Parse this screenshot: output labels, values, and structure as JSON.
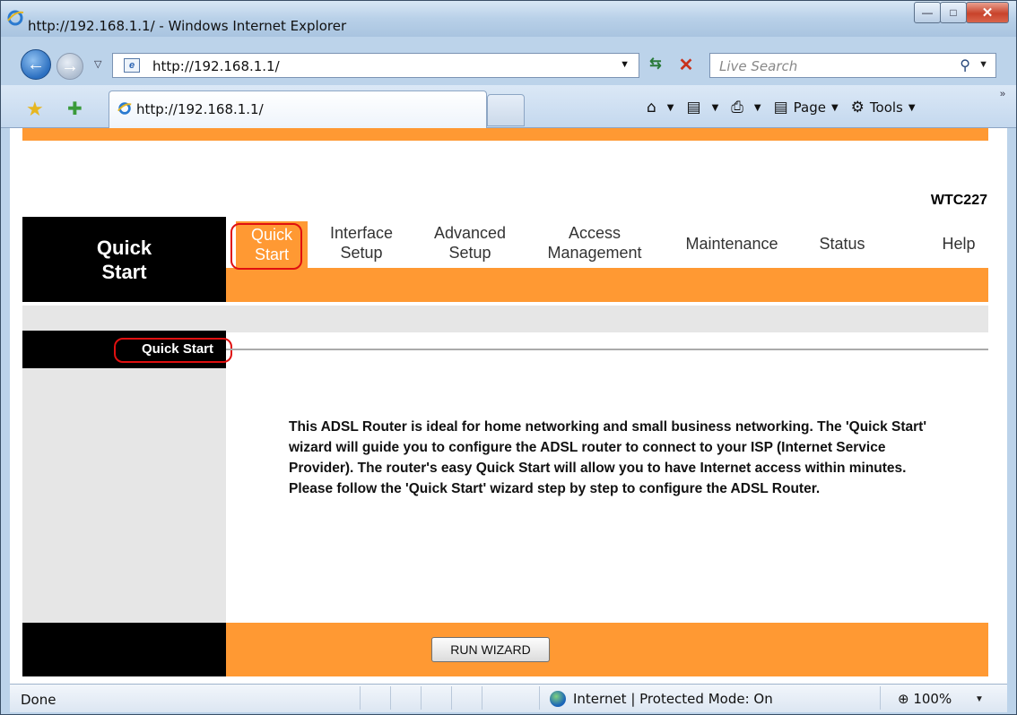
{
  "browser": {
    "window_title": "http://192.168.1.1/ - Windows Internet Explorer",
    "address_url": "http://192.168.1.1/",
    "search_placeholder": "Live Search",
    "tab_title": "http://192.168.1.1/",
    "commands": {
      "page": "Page",
      "tools": "Tools"
    }
  },
  "router": {
    "model": "WTC227",
    "sidebar_title": "Quick Start",
    "menu": [
      {
        "label": "Quick Start",
        "active": true
      },
      {
        "label": "Interface Setup",
        "active": false
      },
      {
        "label": "Advanced Setup",
        "active": false
      },
      {
        "label": "Access Management",
        "active": false
      },
      {
        "label": "Maintenance",
        "active": false
      },
      {
        "label": "Status",
        "active": false
      },
      {
        "label": "Help",
        "active": false
      }
    ],
    "section_title": "Quick Start",
    "description": "This ADSL Router is ideal for home networking and small business networking. The 'Quick Start' wizard will guide you to configure the ADSL router to connect to your ISP (Internet Service Provider). The router's easy Quick Start will allow you to have Internet access within minutes. Please follow the 'Quick Start' wizard step by step to configure the ADSL Router.",
    "run_wizard_label": "RUN WIZARD",
    "accent_color": "#ff9933",
    "highlight_color": "#e01010"
  },
  "statusbar": {
    "status": "Done",
    "zone": "Internet | Protected Mode: On",
    "zoom": "100%"
  }
}
